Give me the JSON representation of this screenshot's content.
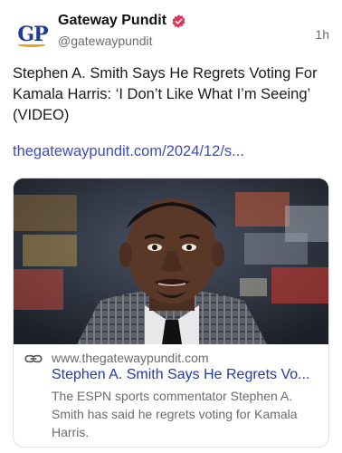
{
  "account": {
    "avatar_text": "GP",
    "display_name": "Gateway Pundit",
    "handle": "@gatewaypundit",
    "timestamp": "1h"
  },
  "post": {
    "text": "Stephen A. Smith Says He Regrets Voting For Kamala Harris: ‘I Don’t Like What I’m Seeing’ (VIDEO)",
    "link_text": "thegatewaypundit.com/2024/12/s..."
  },
  "card": {
    "domain": "www.thegatewaypundit.com",
    "title": "Stephen A. Smith Says He Regrets Vo...",
    "description": "The ESPN sports commentator Stephen A. Smith has said he regrets voting for Kamala Harris."
  },
  "colors": {
    "verified_badge": "#e2335c",
    "link": "#3b4bc7",
    "brand_blue": "#1f3a93",
    "brand_gold": "#e8a21a"
  },
  "icons": {
    "verified": "verified-badge-icon",
    "link": "link-chain-icon"
  }
}
